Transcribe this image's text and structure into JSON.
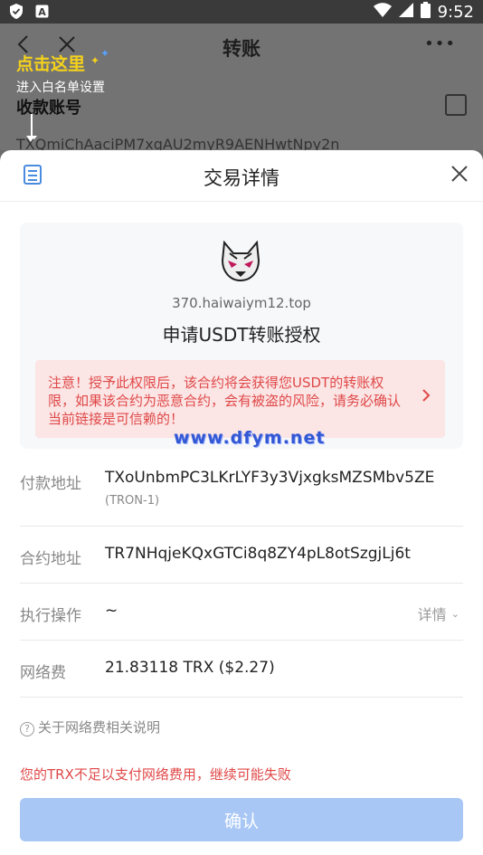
{
  "status_bar": {
    "time": "9:52"
  },
  "background_page": {
    "title": "转账",
    "tip_title": "点击这里",
    "tip_subtitle": "进入白名单设置",
    "field_label": "收款账号",
    "address_partial": "TXQmiChAaciPM7xqAU2myR9AENHwtNpy2n",
    "more_label": "•••"
  },
  "sheet": {
    "title": "交易详情",
    "card": {
      "domain": "370.haiwaiym12.top",
      "request_title": "申请USDT转账授权",
      "warning": "注意！授予此权限后，该合约将会获得您USDT的转账权限，如果该合约为恶意合约，会有被盗的风险，请务必确认当前链接是可信赖的！"
    },
    "watermark": "www.dfym.net",
    "rows": [
      {
        "label": "付款地址",
        "value": "TXoUnbmPC3LKrLYF3y3VjxgksMZSMbv5ZE",
        "sub": "(TRON-1)"
      },
      {
        "label": "合约地址",
        "value": "TR7NHqjeKQxGTCi8q8ZY4pL8otSzgjLj6t"
      },
      {
        "label": "执行操作",
        "value": "~",
        "detail": "详情"
      },
      {
        "label": "网络费",
        "value": "21.83118 TRX ($2.27)"
      }
    ],
    "fee_note": "关于网络费相关说明",
    "insufficient_warning": "您的TRX不足以支付网络费用，继续可能失败",
    "confirm_label": "确认"
  }
}
